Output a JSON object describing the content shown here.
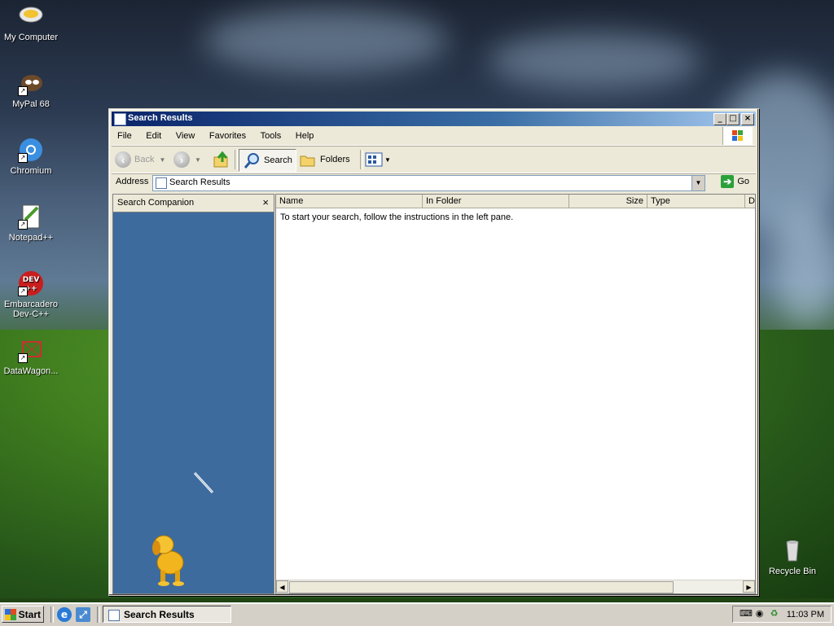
{
  "desktop": {
    "icons": [
      {
        "label": "My Computer"
      },
      {
        "label": "MyPal 68"
      },
      {
        "label": "Chromium"
      },
      {
        "label": "Notepad++"
      },
      {
        "label": "Embarcadero Dev-C++"
      },
      {
        "label": "DataWagon..."
      },
      {
        "label": "Recycle Bin"
      }
    ]
  },
  "window": {
    "title": "Search Results",
    "menu": [
      "File",
      "Edit",
      "View",
      "Favorites",
      "Tools",
      "Help"
    ],
    "toolbar": {
      "back_label": "Back",
      "search_label": "Search",
      "folders_label": "Folders"
    },
    "address": {
      "label": "Address",
      "value": "Search Results",
      "go_label": "Go"
    },
    "search_companion": {
      "title": "Search Companion",
      "close_glyph": "×"
    },
    "results": {
      "columns": [
        "Name",
        "In Folder",
        "Size",
        "Type",
        "D"
      ],
      "message": "To start your search, follow the instructions in the left pane."
    }
  },
  "taskbar": {
    "start_label": "Start",
    "task_label": "Search Results",
    "clock": "11:03 PM"
  },
  "colors": {
    "titlebar_start": "#0a246a",
    "titlebar_end": "#a6caf0",
    "companion_bg": "#3d6b9e",
    "face": "#d4d0c8"
  }
}
